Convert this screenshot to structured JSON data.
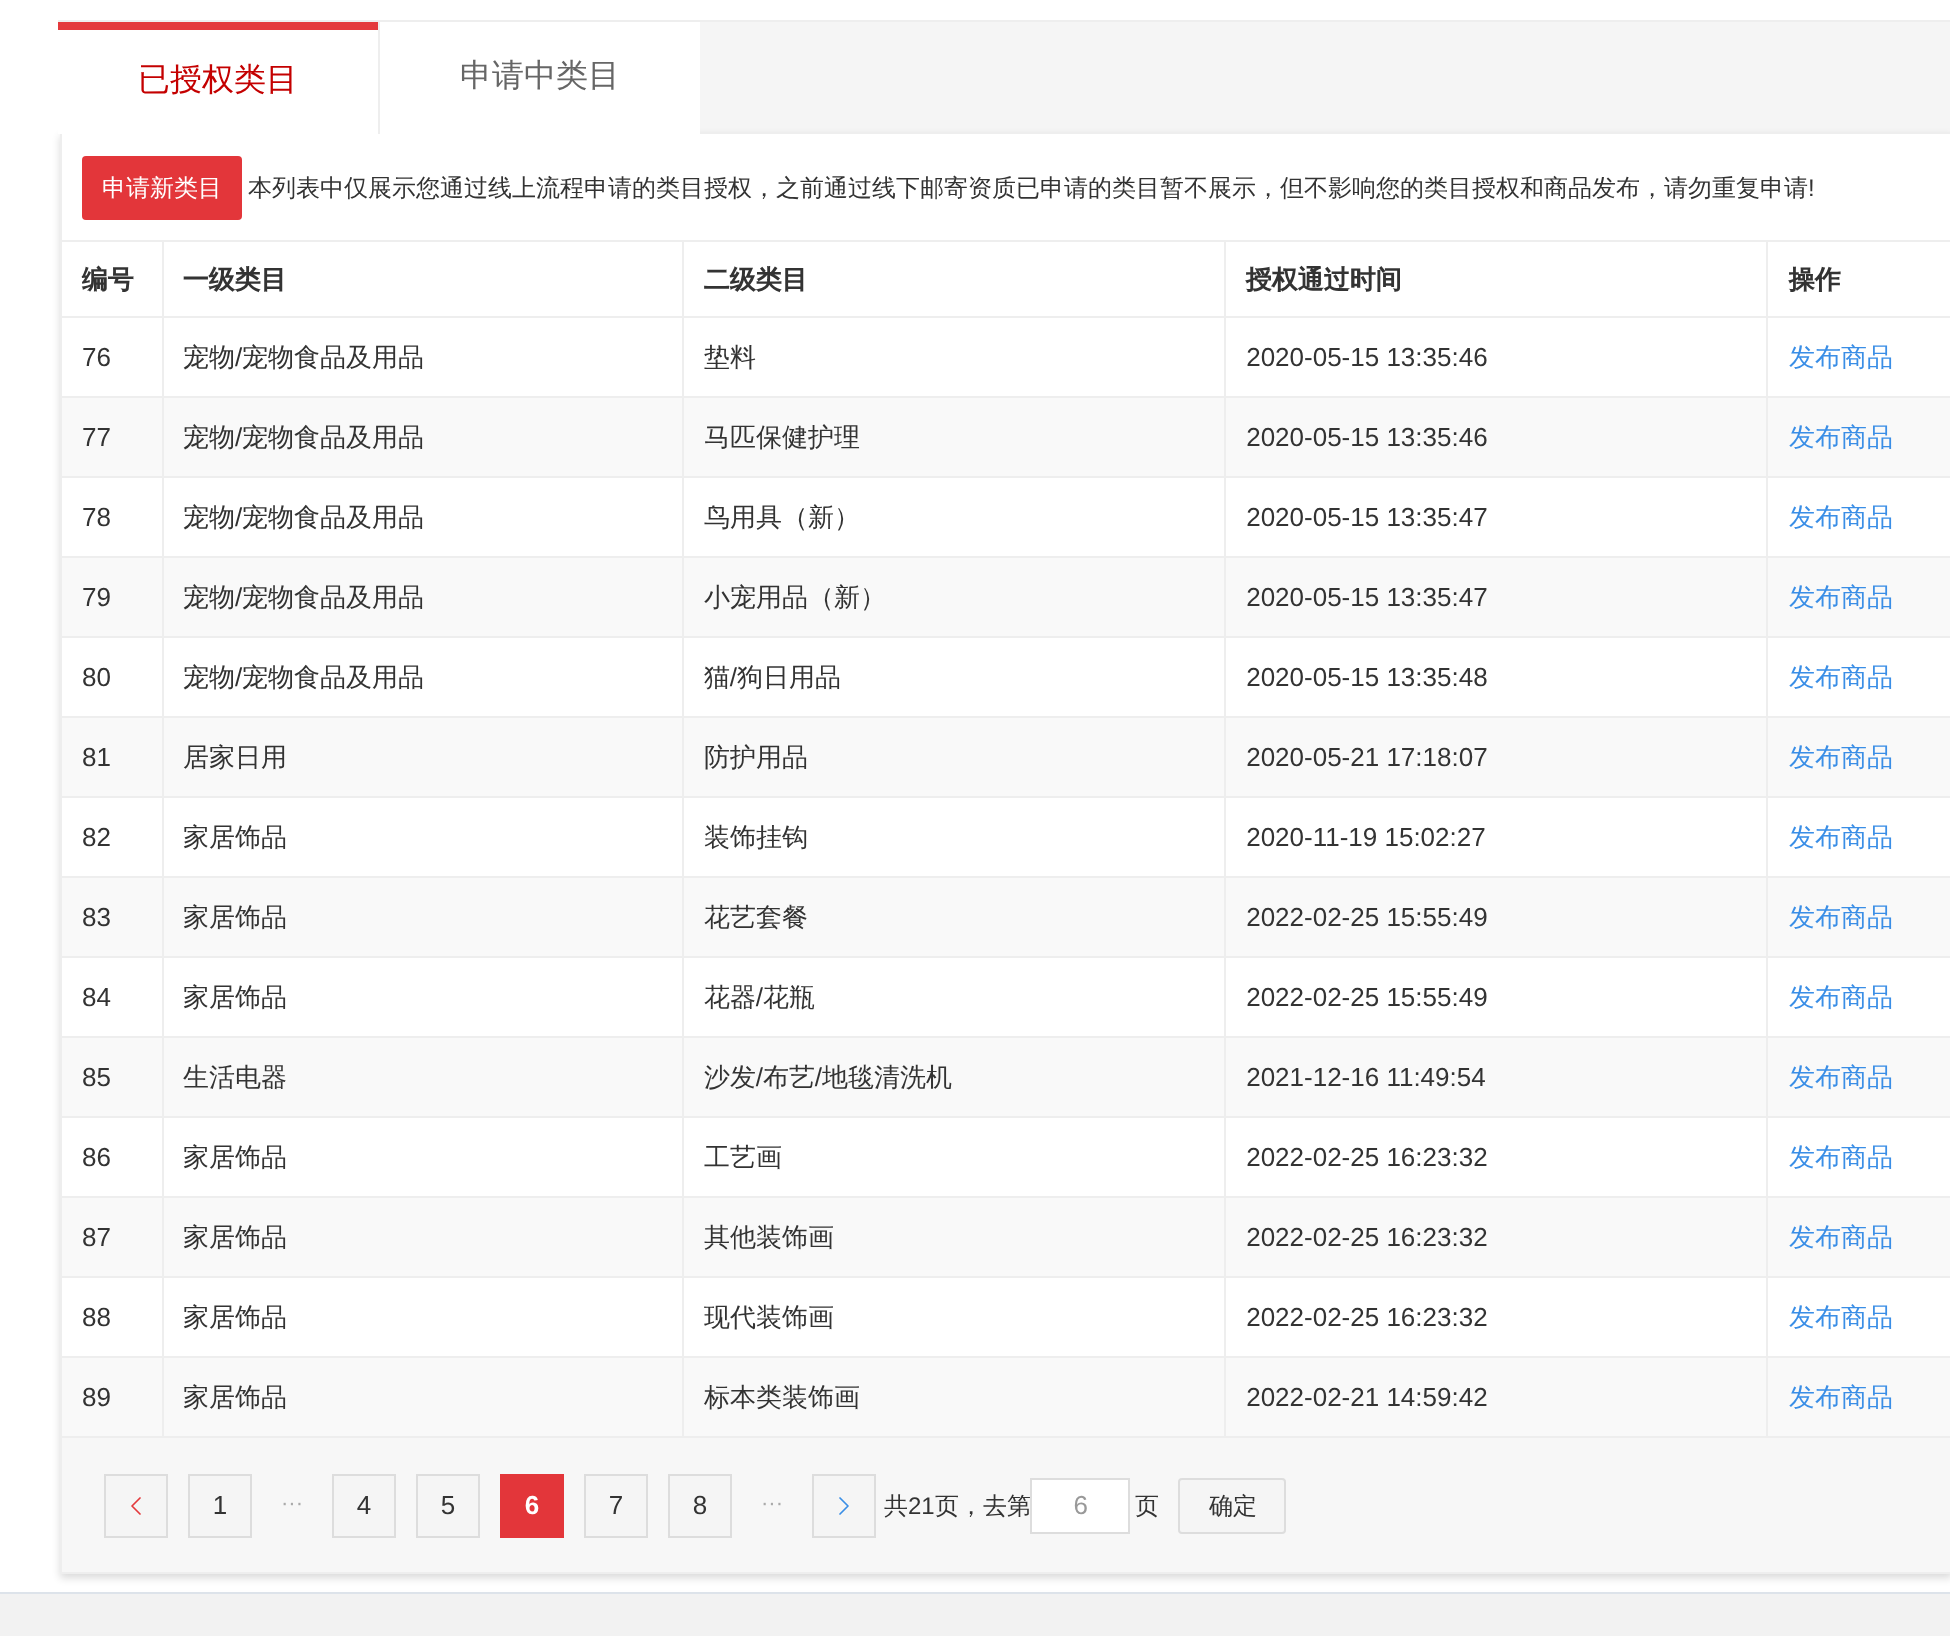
{
  "tabs": [
    {
      "label": "已授权类目",
      "selected": true
    },
    {
      "label": "申请中类目",
      "selected": false
    }
  ],
  "apply_button": "申请新类目",
  "notice": "本列表中仅展示您通过线上流程申请的类目授权，之前通过线下邮寄资质已申请的类目暂不展示，但不影响您的类目授权和商品发布，请勿重复申请!",
  "table": {
    "columns": [
      "编号",
      "一级类目",
      "二级类目",
      "授权通过时间",
      "操作"
    ],
    "rows": [
      [
        "76",
        "宠物/宠物食品及用品",
        "垫料",
        "2020-05-15 13:35:46",
        "发布商品"
      ],
      [
        "77",
        "宠物/宠物食品及用品",
        "马匹保健护理",
        "2020-05-15 13:35:46",
        "发布商品"
      ],
      [
        "78",
        "宠物/宠物食品及用品",
        "鸟用具（新）",
        "2020-05-15 13:35:47",
        "发布商品"
      ],
      [
        "79",
        "宠物/宠物食品及用品",
        "小宠用品（新）",
        "2020-05-15 13:35:47",
        "发布商品"
      ],
      [
        "80",
        "宠物/宠物食品及用品",
        "猫/狗日用品",
        "2020-05-15 13:35:48",
        "发布商品"
      ],
      [
        "81",
        "居家日用",
        "防护用品",
        "2020-05-21 17:18:07",
        "发布商品"
      ],
      [
        "82",
        "家居饰品",
        "装饰挂钩",
        "2020-11-19 15:02:27",
        "发布商品"
      ],
      [
        "83",
        "家居饰品",
        "花艺套餐",
        "2022-02-25 15:55:49",
        "发布商品"
      ],
      [
        "84",
        "家居饰品",
        "花器/花瓶",
        "2022-02-25 15:55:49",
        "发布商品"
      ],
      [
        "85",
        "生活电器",
        "沙发/布艺/地毯清洗机",
        "2021-12-16 11:49:54",
        "发布商品"
      ],
      [
        "86",
        "家居饰品",
        "工艺画",
        "2022-02-25 16:23:32",
        "发布商品"
      ],
      [
        "87",
        "家居饰品",
        "其他装饰画",
        "2022-02-25 16:23:32",
        "发布商品"
      ],
      [
        "88",
        "家居饰品",
        "现代装饰画",
        "2022-02-25 16:23:32",
        "发布商品"
      ],
      [
        "89",
        "家居饰品",
        "标本类装饰画",
        "2022-02-21 14:59:42",
        "发布商品"
      ]
    ]
  },
  "pagination": {
    "items": [
      {
        "kind": "prev"
      },
      {
        "kind": "page",
        "label": "1",
        "selected": false
      },
      {
        "kind": "ellipsis",
        "label": "···"
      },
      {
        "kind": "page",
        "label": "4",
        "selected": false
      },
      {
        "kind": "page",
        "label": "5",
        "selected": false
      },
      {
        "kind": "page",
        "label": "6",
        "selected": true
      },
      {
        "kind": "page",
        "label": "7",
        "selected": false
      },
      {
        "kind": "page",
        "label": "8",
        "selected": false
      },
      {
        "kind": "ellipsis",
        "label": "···"
      },
      {
        "kind": "next"
      }
    ],
    "total_text": "共21页，去第",
    "page_input": {
      "placeholder": "6"
    },
    "page_suffix": "页",
    "confirm_button": "确定"
  }
}
